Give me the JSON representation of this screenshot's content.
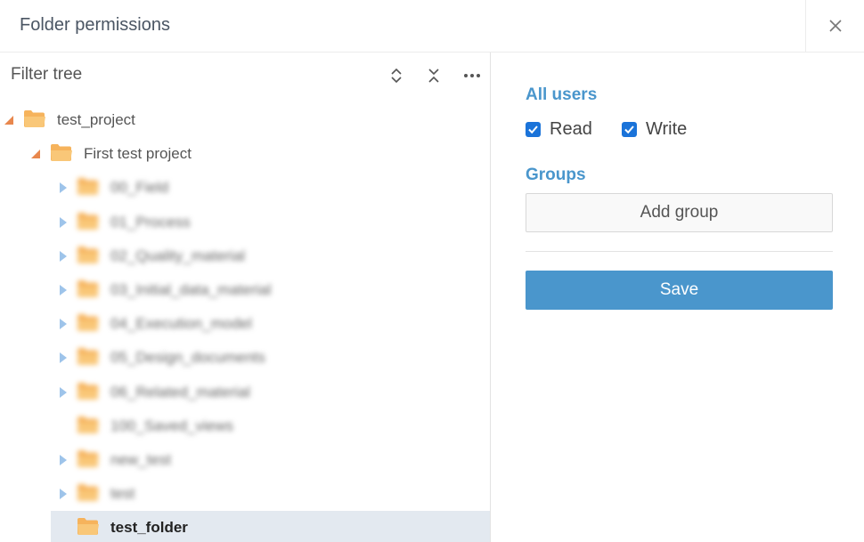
{
  "dialog": {
    "title": "Folder permissions",
    "close_icon": "close-icon"
  },
  "tree": {
    "filter_placeholder": "Filter tree",
    "tools": [
      "expand-collapse-icon",
      "collapse-all-icon",
      "more-icon"
    ],
    "items": [
      {
        "label": "test_project",
        "expanded": true
      },
      {
        "label": "First test project",
        "expanded": true
      },
      {
        "label": "00_Field",
        "blurred": true
      },
      {
        "label": "01_Process",
        "blurred": true
      },
      {
        "label": "02_Quality_material",
        "blurred": true
      },
      {
        "label": "03_Initial_data_material",
        "blurred": true
      },
      {
        "label": "04_Execution_model",
        "blurred": true
      },
      {
        "label": "05_Design_documents",
        "blurred": true
      },
      {
        "label": "06_Related_material",
        "blurred": true
      },
      {
        "label": "100_Saved_views",
        "blurred": true
      },
      {
        "label": "new_test",
        "blurred": true
      },
      {
        "label": "test",
        "blurred": true
      },
      {
        "label": "test_folder",
        "selected": true
      }
    ]
  },
  "permissions": {
    "all_users_heading": "All users",
    "read_label": "Read",
    "read_checked": true,
    "write_label": "Write",
    "write_checked": true,
    "groups_heading": "Groups",
    "add_group_label": "Add group",
    "save_label": "Save"
  },
  "colors": {
    "accent": "#4a96cc",
    "checkbox": "#1a73d9",
    "folder": "#f6b35c",
    "expanded_arrow": "#e8874d",
    "collapsed_arrow": "#9ec4ea"
  }
}
